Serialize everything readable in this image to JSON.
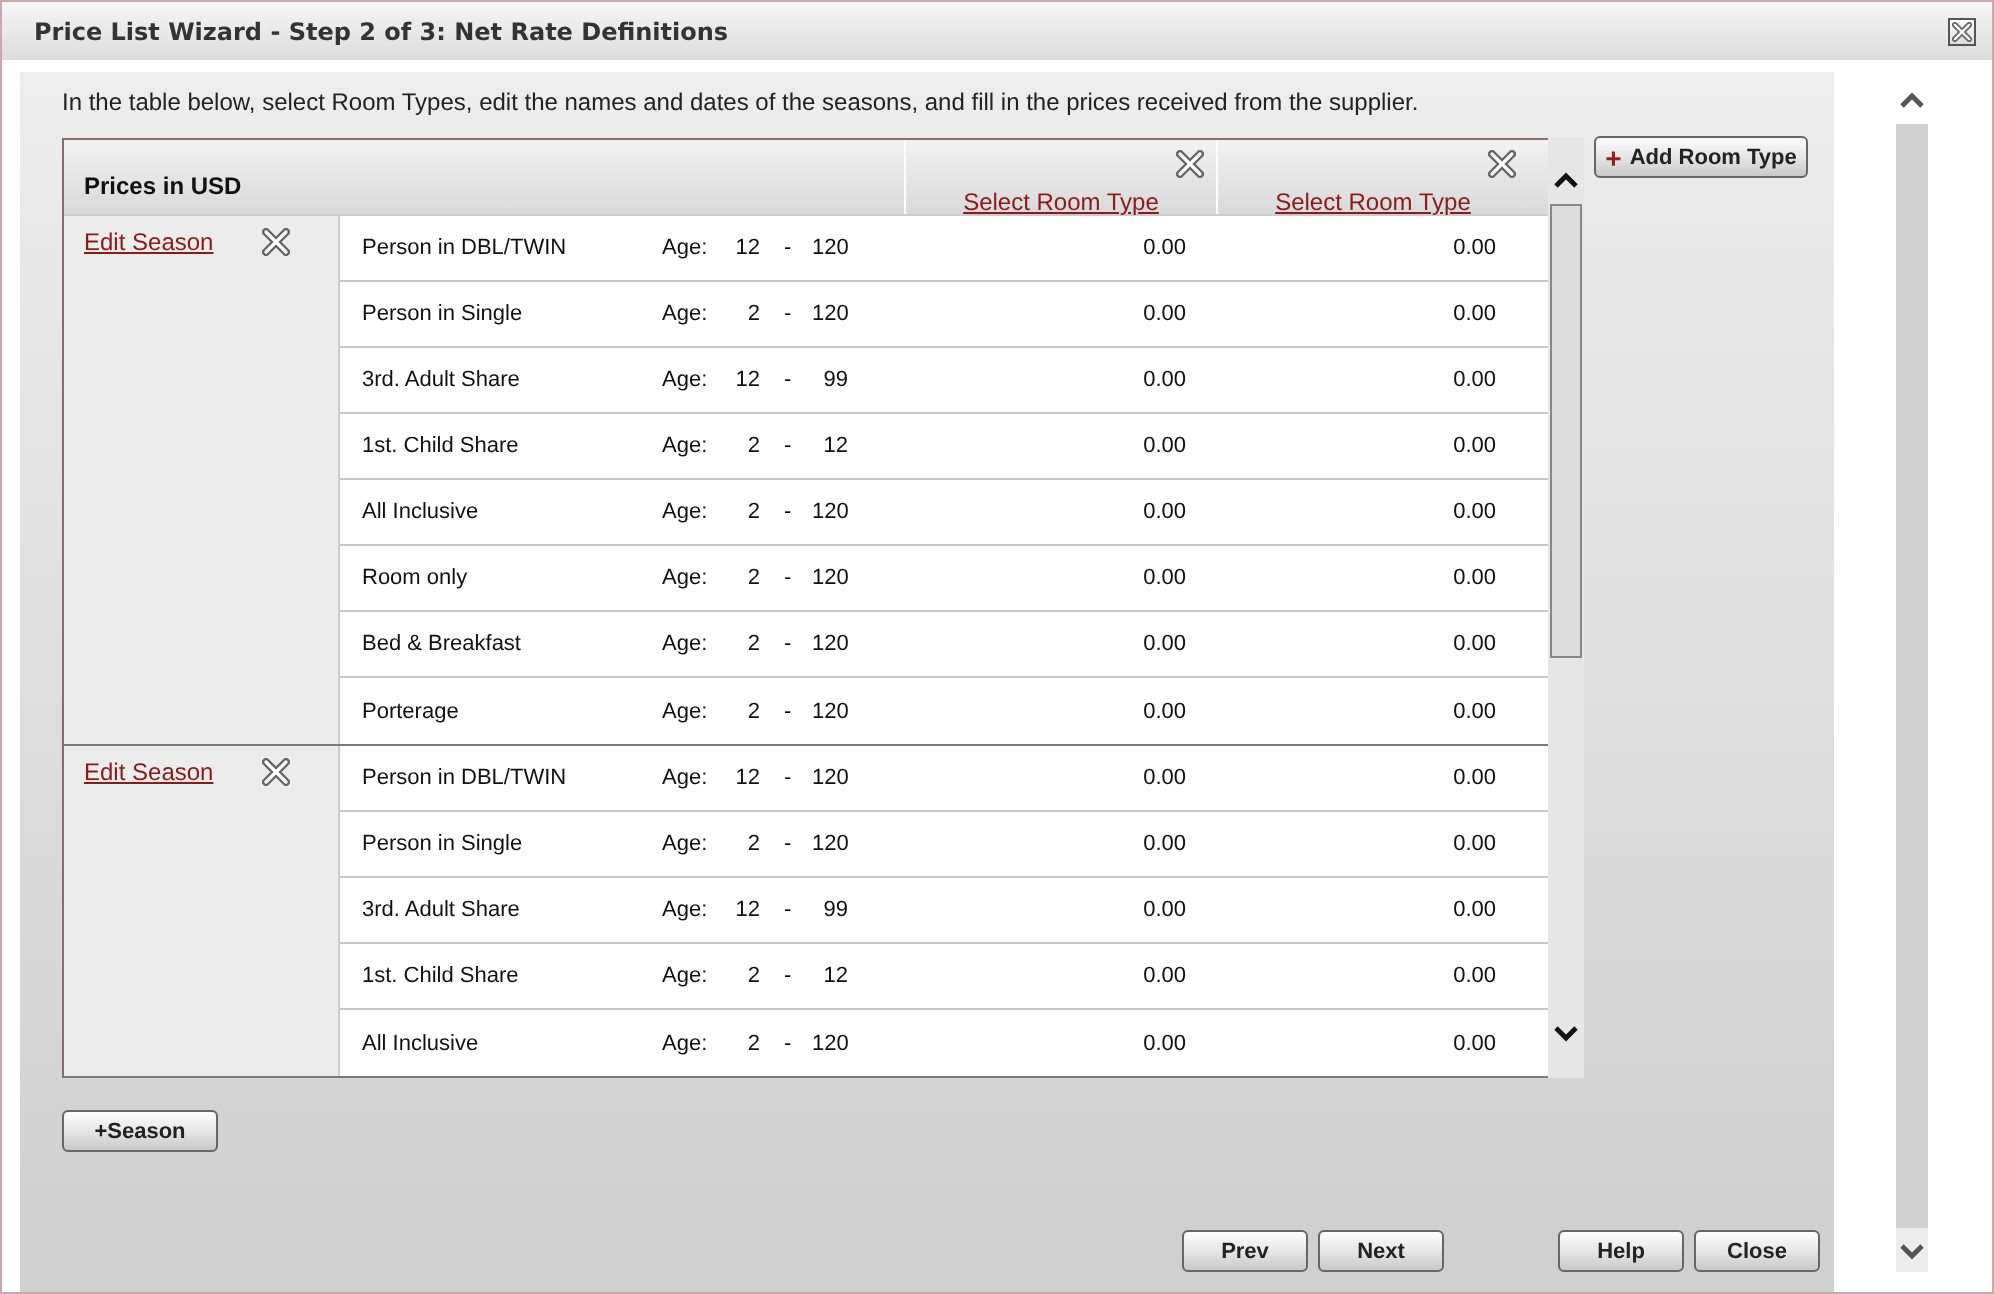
{
  "window": {
    "title": "Price List Wizard - Step 2 of 3: Net Rate Definitions"
  },
  "instruction": "In the table below, select Room Types, edit the names and dates of the seasons, and fill in the prices received from the supplier.",
  "table": {
    "heading": "Prices in USD",
    "room_columns": [
      {
        "link": "Select Room Type"
      },
      {
        "link": "Select Room Type"
      }
    ],
    "seasons": [
      {
        "link": "Edit Season",
        "rows": [
          {
            "name": "Person in DBL/TWIN",
            "age_label": "Age:",
            "age_from": "12",
            "separator": "-",
            "age_to": "120",
            "prices": [
              "0.00",
              "0.00"
            ]
          },
          {
            "name": "Person in Single",
            "age_label": "Age:",
            "age_from": "2",
            "separator": "-",
            "age_to": "120",
            "prices": [
              "0.00",
              "0.00"
            ]
          },
          {
            "name": "3rd. Adult Share",
            "age_label": "Age:",
            "age_from": "12",
            "separator": "-",
            "age_to": "99",
            "prices": [
              "0.00",
              "0.00"
            ]
          },
          {
            "name": "1st. Child Share",
            "age_label": "Age:",
            "age_from": "2",
            "separator": "-",
            "age_to": "12",
            "prices": [
              "0.00",
              "0.00"
            ]
          },
          {
            "name": "All Inclusive",
            "age_label": "Age:",
            "age_from": "2",
            "separator": "-",
            "age_to": "120",
            "prices": [
              "0.00",
              "0.00"
            ]
          },
          {
            "name": "Room only",
            "age_label": "Age:",
            "age_from": "2",
            "separator": "-",
            "age_to": "120",
            "prices": [
              "0.00",
              "0.00"
            ]
          },
          {
            "name": "Bed & Breakfast",
            "age_label": "Age:",
            "age_from": "2",
            "separator": "-",
            "age_to": "120",
            "prices": [
              "0.00",
              "0.00"
            ]
          },
          {
            "name": "Porterage",
            "age_label": "Age:",
            "age_from": "2",
            "separator": "-",
            "age_to": "120",
            "prices": [
              "0.00",
              "0.00"
            ]
          }
        ]
      },
      {
        "link": "Edit Season",
        "rows": [
          {
            "name": "Person in DBL/TWIN",
            "age_label": "Age:",
            "age_from": "12",
            "separator": "-",
            "age_to": "120",
            "prices": [
              "0.00",
              "0.00"
            ]
          },
          {
            "name": "Person in Single",
            "age_label": "Age:",
            "age_from": "2",
            "separator": "-",
            "age_to": "120",
            "prices": [
              "0.00",
              "0.00"
            ]
          },
          {
            "name": "3rd. Adult Share",
            "age_label": "Age:",
            "age_from": "12",
            "separator": "-",
            "age_to": "99",
            "prices": [
              "0.00",
              "0.00"
            ]
          },
          {
            "name": "1st. Child Share",
            "age_label": "Age:",
            "age_from": "2",
            "separator": "-",
            "age_to": "12",
            "prices": [
              "0.00",
              "0.00"
            ]
          },
          {
            "name": "All Inclusive",
            "age_label": "Age:",
            "age_from": "2",
            "separator": "-",
            "age_to": "120",
            "prices": [
              "0.00",
              "0.00"
            ]
          }
        ]
      }
    ]
  },
  "add_room_type_button": {
    "icon": "+",
    "label": "Add Room Type"
  },
  "add_season_button": "+Season",
  "nav_buttons": [
    "Prev",
    "Next"
  ],
  "action_buttons": [
    "Help",
    "Close"
  ]
}
